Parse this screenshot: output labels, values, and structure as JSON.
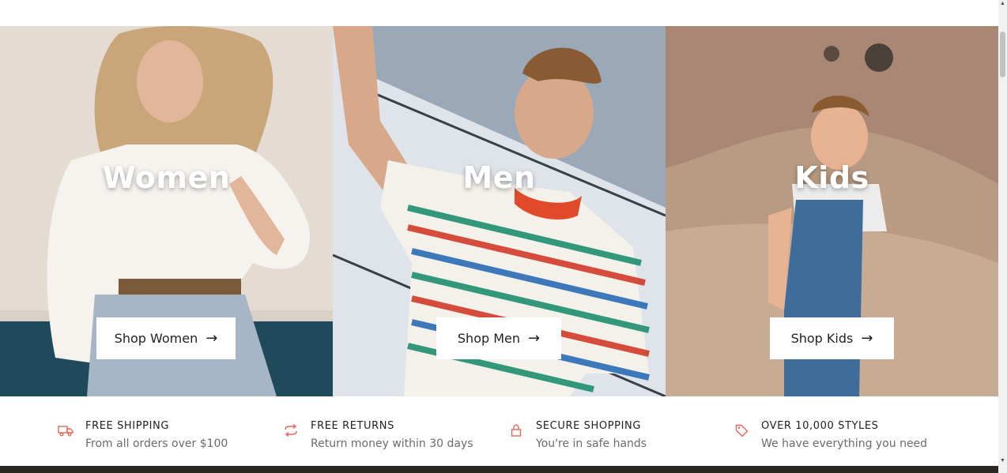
{
  "banners": [
    {
      "title": "Women",
      "button_label": "Shop Women",
      "arrow": "→"
    },
    {
      "title": "Men",
      "button_label": "Shop Men",
      "arrow": "→"
    },
    {
      "title": "Kids",
      "button_label": "Shop Kids",
      "arrow": "→"
    }
  ],
  "features": [
    {
      "icon": "truck-icon",
      "title": "FREE SHIPPING",
      "subtitle": "From all orders over $100"
    },
    {
      "icon": "returns-icon",
      "title": "FREE RETURNS",
      "subtitle": "Return money within 30 days"
    },
    {
      "icon": "lock-icon",
      "title": "SECURE SHOPPING",
      "subtitle": "You're in safe hands"
    },
    {
      "icon": "tag-icon",
      "title": "OVER 10,000 STYLES",
      "subtitle": "We have everything you need"
    }
  ],
  "colors": {
    "accent": "#e8645a",
    "text_dark": "#222222",
    "text_muted": "#6b6b6b"
  }
}
